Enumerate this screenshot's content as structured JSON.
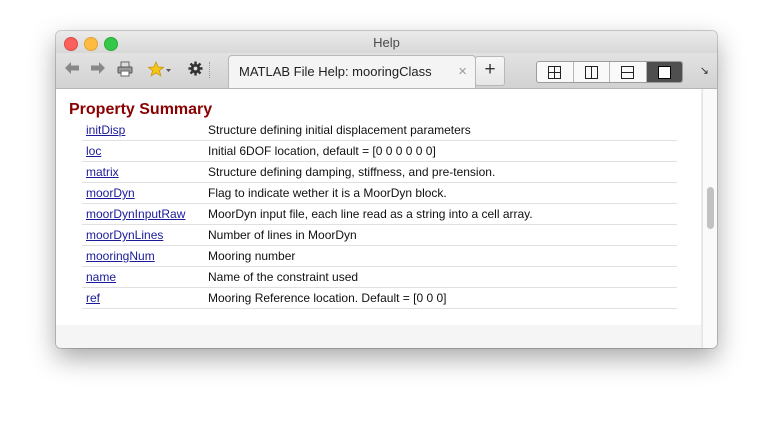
{
  "window": {
    "title": "Help"
  },
  "toolbar": {
    "back_icon": "back-arrow-icon",
    "forward_icon": "forward-arrow-icon",
    "print_icon": "printer-icon",
    "favorites_icon": "star-icon",
    "settings_icon": "gear-icon",
    "tab_label": "MATLAB File Help: mooringClass",
    "new_tab_label": "+",
    "layout_buttons": [
      "grid-2x2-icon",
      "split-vertical-icon",
      "split-horizontal-icon",
      "single-panel-icon"
    ]
  },
  "content": {
    "heading": "Property Summary",
    "properties": [
      {
        "name": "initDisp",
        "description": "Structure defining initial displacement parameters"
      },
      {
        "name": "loc",
        "description": "Initial 6DOF location, default = [0 0 0 0 0 0]"
      },
      {
        "name": "matrix",
        "description": "Structure defining damping, stiffness, and pre-tension."
      },
      {
        "name": "moorDyn",
        "description": "Flag to indicate wether it is a MoorDyn block."
      },
      {
        "name": "moorDynInputRaw",
        "description": "MoorDyn input file, each line read as a string into a cell array."
      },
      {
        "name": "moorDynLines",
        "description": "Number of lines in MoorDyn"
      },
      {
        "name": "mooringNum",
        "description": "Mooring number"
      },
      {
        "name": "name",
        "description": "Name of the constraint used"
      },
      {
        "name": "ref",
        "description": "Mooring Reference location. Default = [0 0 0]"
      }
    ]
  },
  "colors": {
    "heading": "#8b0000",
    "link": "#1a1a9a"
  }
}
